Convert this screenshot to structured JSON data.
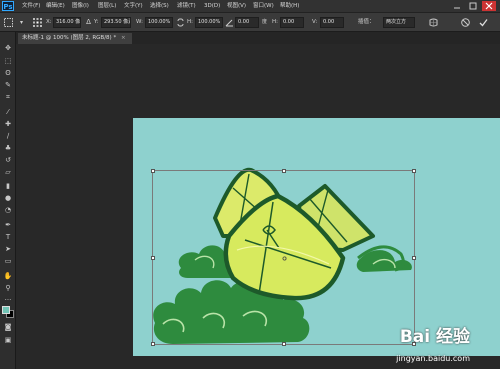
{
  "app": {
    "logo": "Ps"
  },
  "menu": [
    "文件(F)",
    "编辑(E)",
    "图像(I)",
    "图层(L)",
    "文字(Y)",
    "选择(S)",
    "滤镜(T)",
    "3D(D)",
    "视图(V)",
    "窗口(W)",
    "帮助(H)"
  ],
  "options": {
    "x_label": "X:",
    "x_value": "316.00 像素",
    "y_label": "Y:",
    "y_value": "293.50 像素",
    "w_label": "W:",
    "w_value": "100.00%",
    "h_label": "H:",
    "h_value": "100.00%",
    "angle_value": "0.00",
    "hskew_label": "H:",
    "hskew_value": "0.00",
    "vskew_label": "V:",
    "vskew_value": "0.00",
    "interp_label": "插值：",
    "interp_value": "两次立方"
  },
  "document": {
    "tab_label": "未标题-1 @ 100% (图层 2, RGB/8) *"
  },
  "colors": {
    "canvas": "#8ed1ce",
    "foreground": "#71c3b5",
    "background": "#000000"
  },
  "watermark": {
    "logo": "Bai 经验",
    "url": "jingyan.baidu.com"
  }
}
